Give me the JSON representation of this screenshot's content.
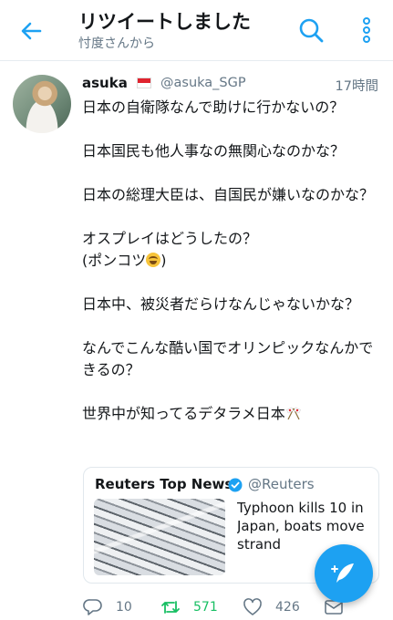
{
  "header": {
    "title": "リツイートしました",
    "subtitle": "忖度さんから",
    "icons": {
      "back": "back-arrow-icon",
      "search": "search-icon",
      "more": "more-vertical-icon"
    },
    "accent_color": "#1da1f2"
  },
  "tweet": {
    "user_name": "asuka",
    "flag_icon": "singapore-flag-icon",
    "handle": "@asuka_SGP",
    "time": "17時間",
    "line1": "日本の自衛隊なんで助けに行かないの？",
    "line2": "日本国民も他人事なの無関心なのかな？",
    "line3": "日本の総理大臣は、自国民が嫌いなのかな？",
    "line4": "オスプレイはどうしたの？",
    "line5_start": "(ポンコツ",
    "line5_end": ")",
    "line6": "日本中、被災者だらけなんじゃないかな？",
    "line7": "なんでこんな酷い国でオリンピックなんかできるの？",
    "line8": "世界中が知ってるデタラメ日本",
    "emoji_laughing": "laughing-emoji-icon",
    "emoji_flags": "crossed-flags-emoji-icon"
  },
  "quoted": {
    "name": "Reuters Top News",
    "verified_icon": "verified-badge-icon",
    "handle": "@Reuters",
    "text": "Typhoon kills 10 in Japan, boats move strand",
    "image": "boats-stranded-photo"
  },
  "actions": {
    "reply_count": "10",
    "retweet_count": "571",
    "like_count": "426",
    "retweet_color": "#17bf63",
    "icons": [
      "reply-icon",
      "retweet-icon",
      "like-icon",
      "dm-icon"
    ]
  },
  "fab": {
    "icon": "compose-feather-icon"
  }
}
